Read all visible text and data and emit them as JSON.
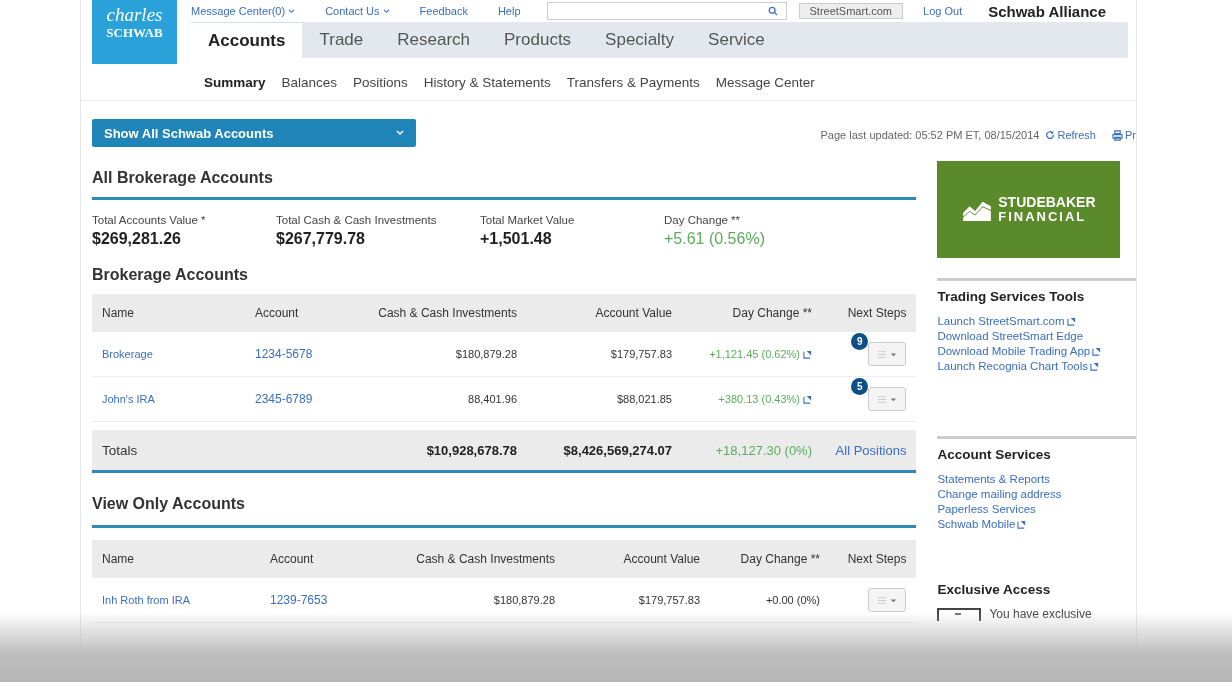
{
  "logo": {
    "line1": "charles",
    "line2": "SCHWAB"
  },
  "top_links": [
    {
      "label": "Message Center(0)",
      "caret": true
    },
    {
      "label": "Contact Us",
      "caret": true
    },
    {
      "label": "Feedback",
      "caret": false
    },
    {
      "label": "Help",
      "caret": false
    }
  ],
  "streetsmart_button": "StreetSmart.com",
  "logout": "Log Out",
  "alliance": "Schwab Alliance",
  "tabs": [
    {
      "label": "Accounts",
      "selected": true
    },
    {
      "label": "Trade",
      "selected": false
    },
    {
      "label": "Research",
      "selected": false
    },
    {
      "label": "Products",
      "selected": false
    },
    {
      "label": "Specialty",
      "selected": false
    },
    {
      "label": "Service",
      "selected": false
    }
  ],
  "subtabs": [
    {
      "label": "Summary",
      "selected": true
    },
    {
      "label": "Balances",
      "selected": false
    },
    {
      "label": "Positions",
      "selected": false
    },
    {
      "label": "History & Statements",
      "selected": false
    },
    {
      "label": "Transfers & Payments",
      "selected": false
    },
    {
      "label": "Message Center",
      "selected": false
    }
  ],
  "account_selector": "Show All Schwab Accounts",
  "updated": {
    "text": "Page last updated: 05:52 PM ET, 08/15/2014",
    "refresh": "Refresh",
    "print": "Pr"
  },
  "summary": {
    "title": "All Brokerage Accounts",
    "stats": [
      {
        "label": "Total Accounts Value *",
        "value": "$269,281.26",
        "kind": "plain"
      },
      {
        "label": "Total Cash & Cash Investments",
        "value": "$267,779.78",
        "kind": "plain"
      },
      {
        "label": "Total Market Value",
        "value": "+1,501.48",
        "kind": "plain"
      },
      {
        "label": "Day Change **",
        "value": "+5.61 (0.56%)",
        "kind": "gain"
      }
    ]
  },
  "brokerage": {
    "title": "Brokerage Accounts",
    "columns": [
      "Name",
      "Account",
      "Cash & Cash Investments",
      "Account Value",
      "Day Change **",
      "Next Steps"
    ],
    "rows": [
      {
        "name": "Brokerage",
        "account": "1234-5678",
        "cash": "$180,879.28",
        "value": "$179,757.83",
        "change": "+1,121.45 (0.62%)",
        "badge": "9"
      },
      {
        "name": "John's IRA",
        "account": "2345-6789",
        "cash": "88,401.96",
        "value": "$88,021.85",
        "change": "+380.13 (0.43%)",
        "badge": "5"
      }
    ],
    "totals": {
      "label": "Totals",
      "cash": "$10,928,678.78",
      "value": "$8,426,569,274.07",
      "change": "+18,127.30 (0%)",
      "link": "All Positions"
    }
  },
  "view_only": {
    "title": "View Only Accounts",
    "columns": [
      "Name",
      "Account",
      "Cash & Cash Investments",
      "Account Value",
      "Day Change **",
      "Next Steps"
    ],
    "rows": [
      {
        "name": "Inh Roth from IRA",
        "account": "1239-7653",
        "cash": "$180,879.28",
        "value": "$179,757.83",
        "change": "+0.00 (0%)"
      }
    ]
  },
  "sidebar": {
    "banner": {
      "line1": "STUDEBAKER",
      "line2": "FINANCIAL"
    },
    "sections": [
      {
        "title": "Trading Services Tools",
        "links": [
          {
            "label": "Launch StreetSmart.com",
            "external": true
          },
          {
            "label": "Download StreetSmart Edge",
            "external": false
          },
          {
            "label": "Download Mobile Trading App",
            "external": true
          },
          {
            "label": "Launch Recognia Chart Tools",
            "external": true
          }
        ]
      },
      {
        "title": "Account Services",
        "links": [
          {
            "label": "Statements & Reports",
            "external": false
          },
          {
            "label": "Change mailing address",
            "external": false
          },
          {
            "label": "Paperless Services",
            "external": false
          },
          {
            "label": "Schwab Mobile",
            "external": true
          }
        ]
      }
    ],
    "exclusive": {
      "title": "Exclusive Access",
      "text": "You have exclusive"
    }
  }
}
